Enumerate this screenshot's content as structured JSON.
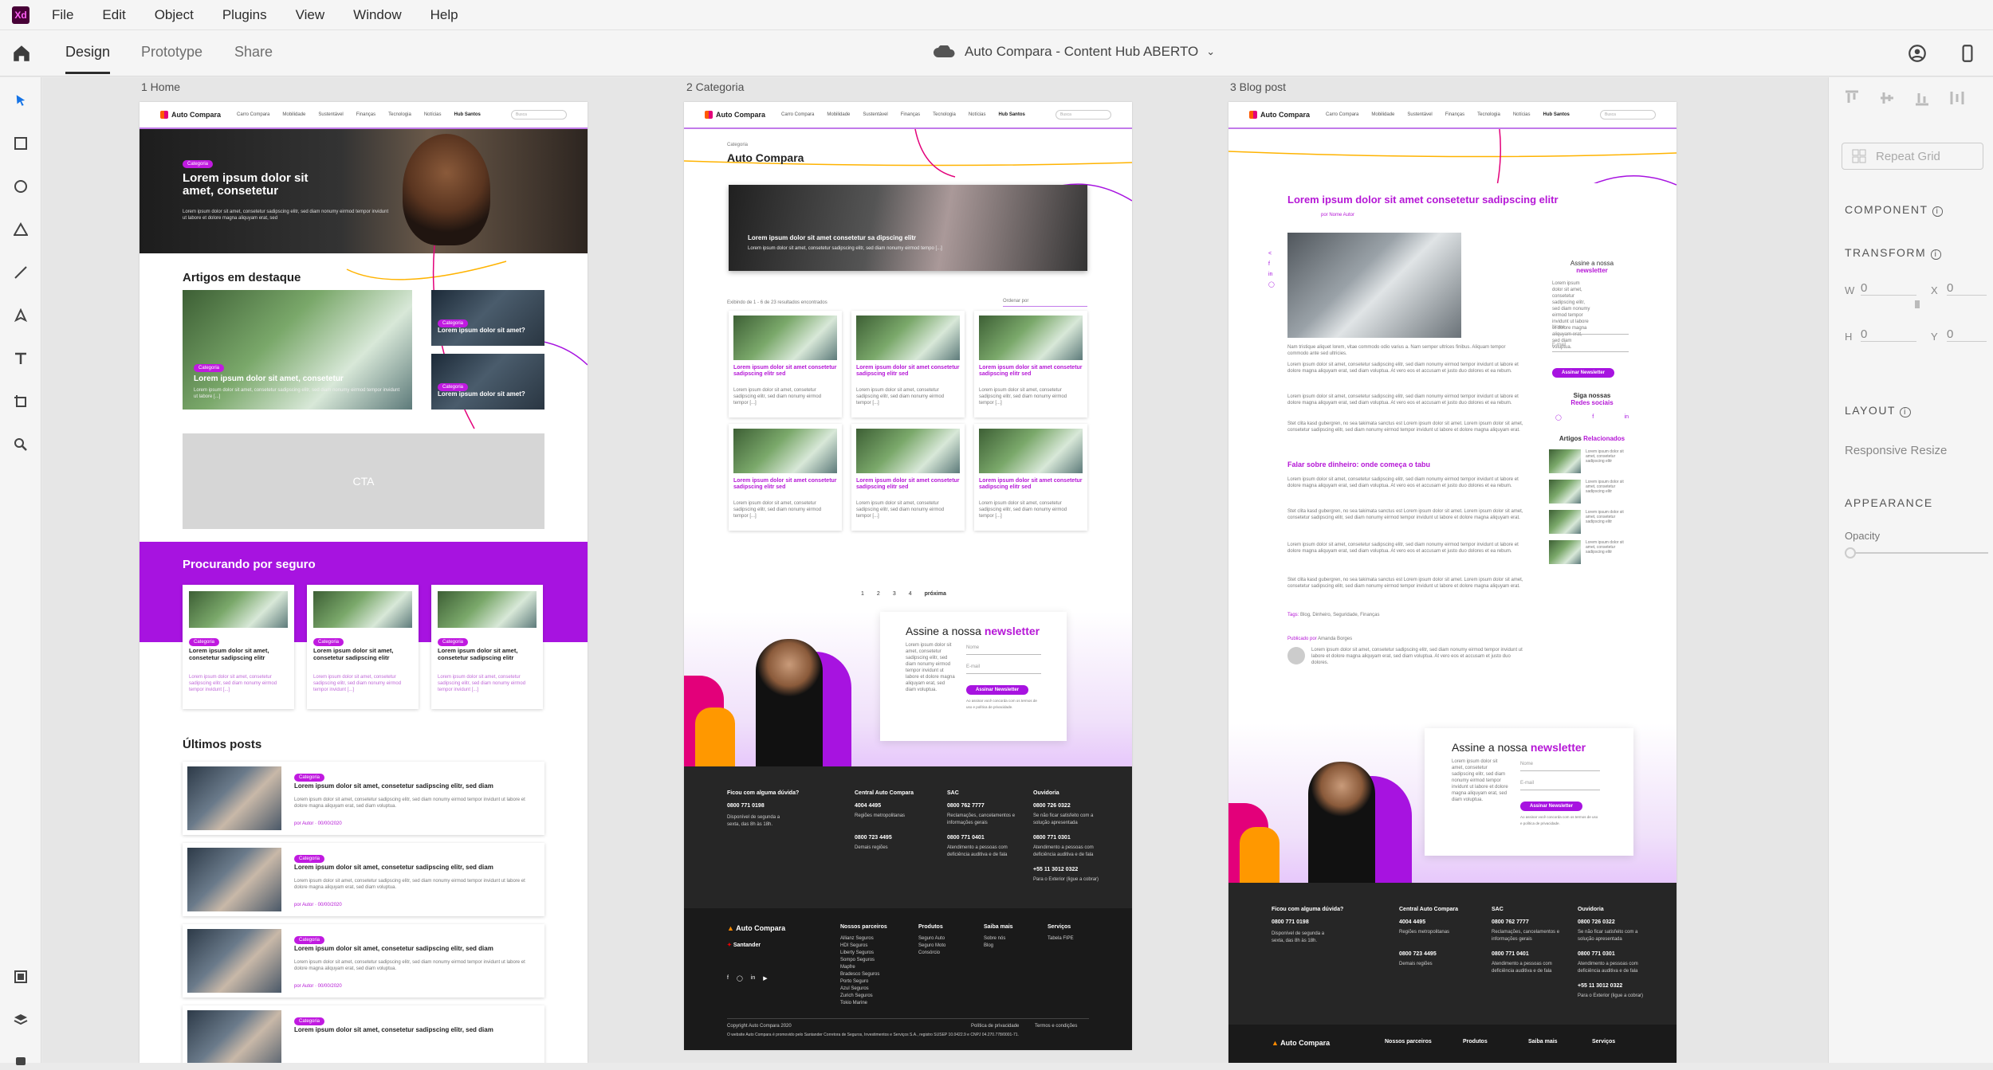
{
  "app": {
    "logo_text": "Xd",
    "doc_title": "Auto Compara - Content Hub ABERTO"
  },
  "menu": [
    "File",
    "Edit",
    "Object",
    "Plugins",
    "View",
    "Window",
    "Help"
  ],
  "modes": {
    "design": "Design",
    "prototype": "Prototype",
    "share": "Share"
  },
  "artboards": {
    "home": "1 Home",
    "category": "2 Categoria",
    "blog": "3 Blog post"
  },
  "nav": {
    "logo": "Auto Compara",
    "links": [
      "Carro Compara",
      "Mobilidade",
      "Sustentável",
      "Finanças",
      "Tecnologia",
      "Notícias"
    ],
    "hub": "Hub Santos",
    "search_placeholder": "Busca"
  },
  "home": {
    "hero_badge": "Categoria",
    "hero_title": "Lorem ipsum dolor sit amet, consetetur",
    "hero_text": "Lorem ipsum dolor sit amet, consetetur sadipscing elitr, sed diam nonumy eirmod tempor invidunt ut labore et dolore magna aliquyam erat, sed",
    "featured_heading": "Artigos em destaque",
    "feat_main_badge": "Categoria",
    "feat_main_title": "Lorem ipsum dolor sit amet, consetetur",
    "feat_main_text": "Lorem ipsum dolor sit amet, consetetur sadipscing elitr, sed diam nonumy eirmod tempor invidunt ut labore [...]",
    "feat_side_badge": "Categoria",
    "feat_side_title": "Lorem ipsum dolor sit amet?",
    "cta": "CTA",
    "seguro_heading": "Procurando por seguro",
    "seguro_card_badge": "Categoria",
    "seguro_card_title": "Lorem ipsum dolor sit amet, consetetur sadipscing elitr",
    "seguro_card_text": "Lorem ipsum dolor sit amet, consetetur sadipscing elitr, sed diam nonumy eirmod tempor invidunt [...]",
    "posts_heading": "Últimos posts",
    "post_badge": "Categoria",
    "post_title": "Lorem ipsum dolor sit amet, consetetur sadipscing elitr, sed diam",
    "post_text": "Lorem ipsum dolor sit amet, consetetur sadipscing elitr, sed diam nonumy eirmod tempor invidunt ut labore et dolore magna aliquyam erat, sed diam voluptua.",
    "post_meta": "por Autor · 00/00/2020"
  },
  "category": {
    "kicker": "Categoria",
    "title": "Auto Compara",
    "hero_title": "Lorem ipsum dolor sit amet consetetur sa dipscing elitr",
    "hero_text": "Lorem ipsum dolor sit amet, consetetur sadipscing elitr, sed diam nonumy eirmod tempo [...]",
    "results": "Exibindo de 1 - 6 de 23 resultados encontrados",
    "order": "Ordenar por",
    "card_title": "Lorem ipsum dolor sit amet consetetur sadipscing elitr sed",
    "card_text": "Lorem ipsum dolor sit amet, consetetur sadipscing elitr, sed diam nonumy eirmod tempor [...]",
    "pages": [
      "1",
      "2",
      "3",
      "4"
    ],
    "next": "próxima",
    "newsletter_title": "Assine a nossa ",
    "newsletter_accent": "newsletter",
    "newsletter_text": "Lorem ipsum dolor sit amet, consetetur sadipscing elitr, sed diam nonumy eirmod tempor invidunt ut labore et dolore magna aliquyam erat, sed diam voluptua.",
    "field_name": "Nome",
    "field_email": "E-mail",
    "newsletter_btn": "Assinar Newsletter",
    "newsletter_note": "Ao assinar você concorda com os termos de uso e política de privacidade."
  },
  "footer": {
    "q": "Ficou com alguma dúvida?",
    "phone1": "0800 771 0198",
    "q_text": "Disponível de segunda a sexta, das 8h às 18h.",
    "central": "Central Auto Compara",
    "central_phone": "4004 4495",
    "central_sub": "Regiões metropolitanas",
    "central_phone2": "0800 723 4495",
    "central_sub2": "Demais regiões",
    "sac": "SAC",
    "sac_phone": "0800 762 7777",
    "sac_sub": "Reclamações, cancelamentos e informações gerais",
    "sac_phone2": "0800 771 0401",
    "sac_sub2": "Atendimento a pessoas com deficiência auditiva e de fala",
    "ouv": "Ouvidoria",
    "ouv_phone": "0800 726 0322",
    "ouv_sub": "Se não ficar satisfeito com a solução apresentada",
    "ouv_phone2": "0800 771 0301",
    "ouv_sub2": "Atendimento a pessoas com deficiência auditiva e de fala",
    "ouv_phone3": "+55 11 3012 0322",
    "ouv_sub3": "Para o Exterior (ligue a cobrar)",
    "brand": "Auto Compara",
    "santander": "Santander",
    "col1": "Nossos parceiros",
    "col1_items": [
      "Allianz Seguros",
      "HDI Seguros",
      "Liberty Seguros",
      "Sompo Seguros",
      "Mapfre",
      "Bradesco Seguros",
      "Porto Seguro",
      "Azul Seguros",
      "Zurich Seguros",
      "Tokio Marine"
    ],
    "col2": "Produtos",
    "col2_items": [
      "Seguro Auto",
      "Seguro Moto",
      "Consórcio"
    ],
    "col3": "Saiba mais",
    "col3_items": [
      "Sobre nós",
      "Blog"
    ],
    "col4": "Serviços",
    "col4_items": [
      "Tabela FIPE"
    ],
    "copyright": "Copyright Auto Compara 2020",
    "privacy": "Política de privacidade",
    "terms": "Termos e condições",
    "legal": "O website Auto Compara é promovido pelo Santander Corretora de Seguros, Investimentos e Serviços S.A., registro SUSEP 10.0422.9 e CNPJ 04.270.778/0001-71."
  },
  "blog": {
    "title": "Lorem ipsum dolor sit amet consetetur sadipscing elitr",
    "author_line": "por Nome Autor",
    "intro": "Nam tristique aliquet lorem, vitae commodo odio varius a. Nam semper ultrices finibus. Aliquam tempor commodo ante sed ultricies.",
    "p1": "Lorem ipsum dolor sit amet, consetetur sadipscing elitr, sed diam nonumy eirmod tempor invidunt ut labore et dolore magna aliquyam erat, sed diam voluptua. At vero eos et accusam et justo duo dolores et ea rebum.",
    "subheading": "Falar sobre dinheiro: onde começa o tabu",
    "p2": "Stet clita kasd gubergren, no sea takimata sanctus est Lorem ipsum dolor sit amet. Lorem ipsum dolor sit amet, consetetur sadipscing elitr, sed diam nonumy eirmod tempor invidunt ut labore et dolore magna aliquyam erat.",
    "tags_label": "Tags:",
    "tags": [
      "Blog",
      "Dinheiro",
      "Seguridade",
      "Finanças"
    ],
    "published": "Publicado por",
    "author": "Amanda Borges",
    "bio": "Lorem ipsum dolor sit amet, consetetur sadipscing elitr, sed diam nonumy eirmod tempor invidunt ut labore et dolore magna aliquyam erat, sed diam voluptua. At vero eos et accusam et justo duo dolores.",
    "side_news": "Assine a nossa",
    "side_news_accent": "newsletter",
    "social_title": "Siga nossas",
    "social_accent": "Redes sociais",
    "related": "Artigos",
    "related_accent": "Relacionados",
    "related_text": "Lorem ipsum dolor sit amet, consetetur sadipscing elitr"
  },
  "properties": {
    "repeat_grid": "Repeat Grid",
    "component": "COMPONENT",
    "transform": "TRANSFORM",
    "w_label": "W",
    "w_value": "0",
    "x_label": "X",
    "x_value": "0",
    "h_label": "H",
    "h_value": "0",
    "y_label": "Y",
    "y_value": "0",
    "layout": "LAYOUT",
    "responsive": "Responsive Resize",
    "appearance": "APPEARANCE",
    "opacity": "Opacity"
  },
  "colors": {
    "accent": "#a713e0",
    "brand_orange": "#ff8a00",
    "footer": "#262626"
  }
}
